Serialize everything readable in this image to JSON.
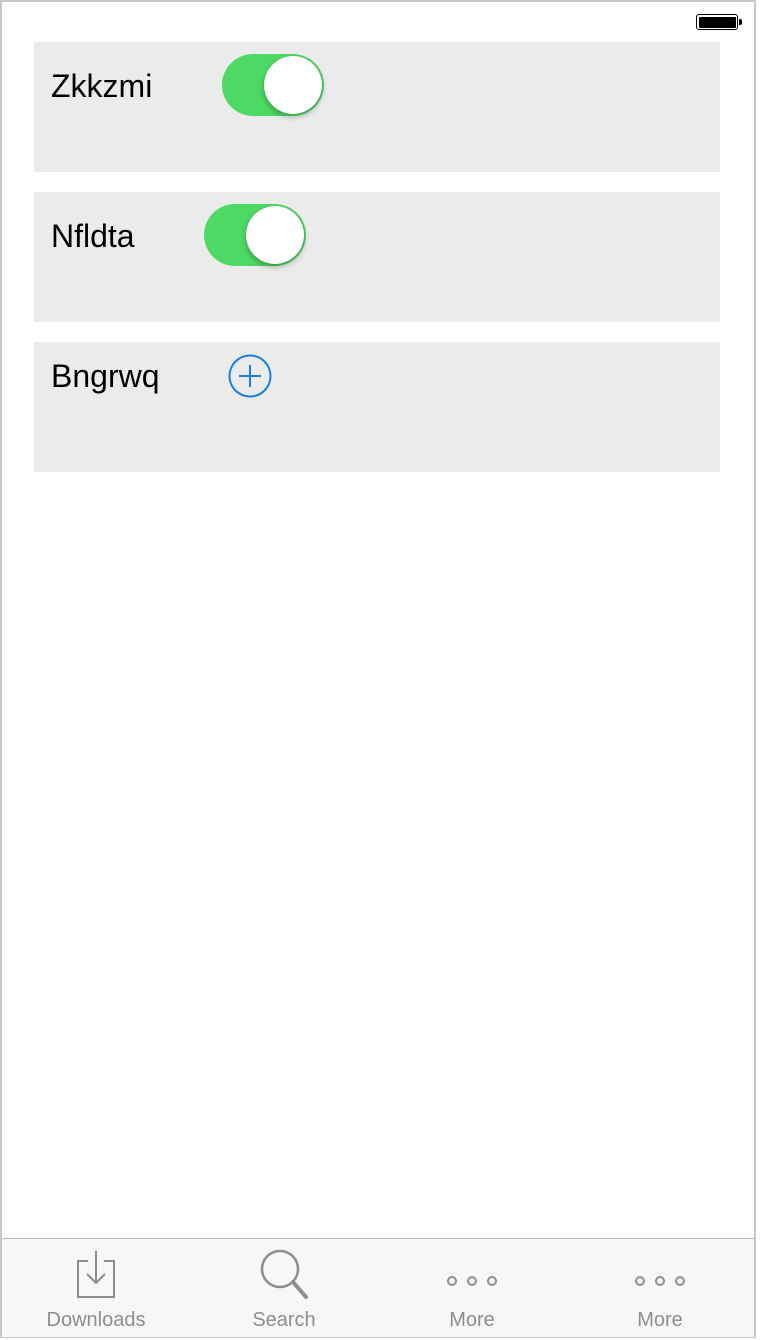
{
  "status_bar": {
    "battery_icon": "battery-full-icon"
  },
  "colors": {
    "toggle_on": "#4cd964",
    "accent_blue": "#1a7ee6",
    "row_background": "#ebebeb",
    "tab_gray": "#8e8e8e"
  },
  "rows": [
    {
      "label": "Zkkzmi",
      "control": "toggle",
      "toggle_on": true
    },
    {
      "label": "Nfldta",
      "control": "toggle",
      "toggle_on": true
    },
    {
      "label": "Bngrwq",
      "control": "add-button",
      "icon": "plus-circle-icon"
    }
  ],
  "tab_bar": {
    "tabs": [
      {
        "label": "Downloads",
        "icon": "download-icon"
      },
      {
        "label": "Search",
        "icon": "search-icon"
      },
      {
        "label": "More",
        "icon": "more-icon"
      },
      {
        "label": "More",
        "icon": "more-icon"
      }
    ]
  }
}
